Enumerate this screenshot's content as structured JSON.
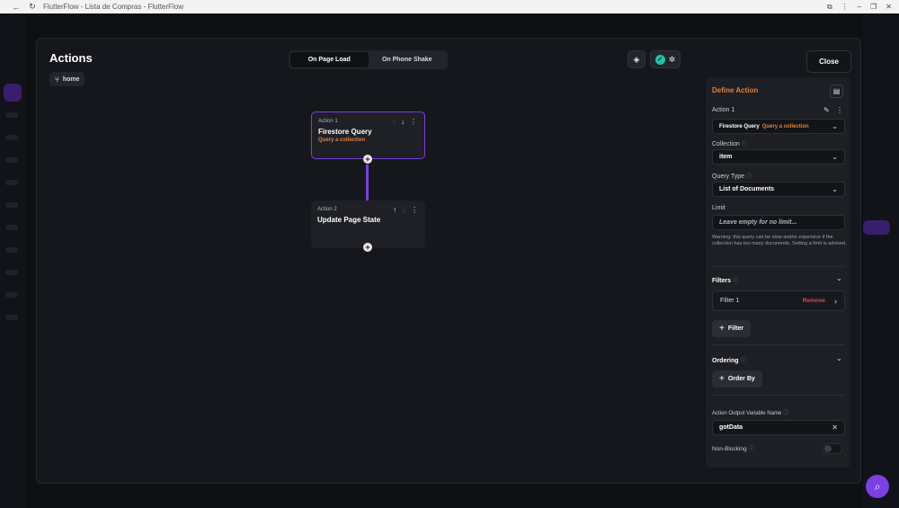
{
  "browser": {
    "tab_title": "FlutterFlow - Lista de Compras - FlutterFlow",
    "back_icon": "←",
    "reload_icon": "↻"
  },
  "modal": {
    "title": "Actions",
    "page_chip": "home",
    "close_label": "Close",
    "trigger_tabs": [
      {
        "label": "On Page Load",
        "active": true
      },
      {
        "label": "On Phone Shake",
        "active": false
      }
    ]
  },
  "actions": [
    {
      "index_label": "Action 1",
      "name": "Firestore Query",
      "subtitle": "Query a collection",
      "selected": true
    },
    {
      "index_label": "Action 2",
      "name": "Update Page State",
      "subtitle": "",
      "selected": false
    }
  ],
  "panel": {
    "title": "Define Action",
    "action_label": "Action 1",
    "action_type": "Firestore Query",
    "action_type_sub": "Query a collection",
    "collection_label": "Collection",
    "collection_value": "item",
    "query_type_label": "Query Type",
    "query_type_value": "List of Documents",
    "limit_label": "Limit",
    "limit_placeholder": "Leave empty for no limit...",
    "warning": "Warning: this query can be slow and/or expensive if the collection has too many documents. Setting a limit is advised.",
    "filters_label": "Filters",
    "filter_item": "Filter 1",
    "filter_remove": "Remove",
    "add_filter_label": "Filter",
    "ordering_label": "Ordering",
    "order_by_label": "Order By",
    "output_var_label": "Action Output Variable Name",
    "output_var_value": "gotData",
    "non_blocking_label": "Non-Blocking"
  },
  "colors": {
    "accent": "#7b3fe4",
    "orange": "#e2803c",
    "danger": "#e04848",
    "success": "#1fc4a8"
  }
}
